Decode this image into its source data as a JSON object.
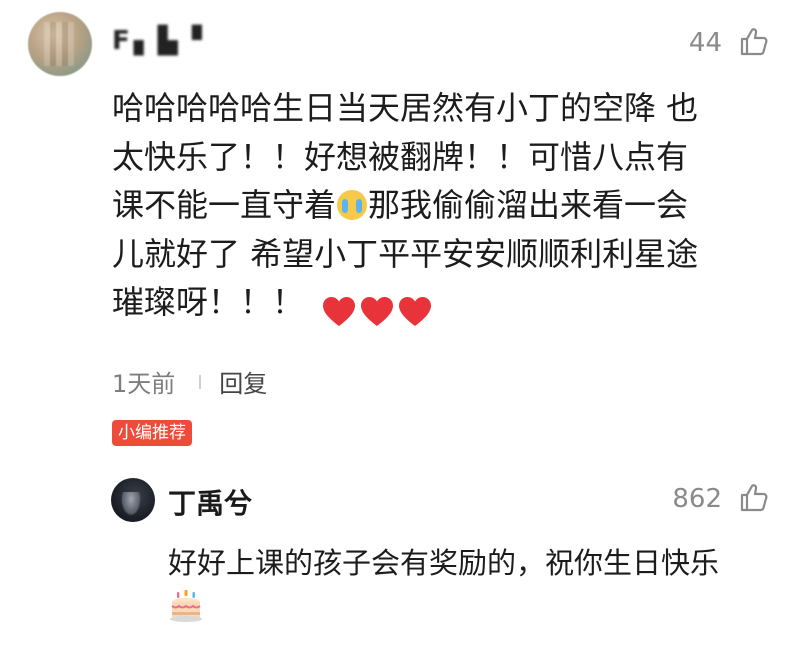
{
  "comment": {
    "username": "F▖▙▝",
    "like_count": "44",
    "text_lines": [
      "哈哈哈哈哈生日当天居然有小丁的空降 也",
      "太快乐了！！好想被翻牌！！可惜八点有",
      "课不能一直守着",
      "那我偷偷溜出来看一会",
      "儿就好了 希望小丁平平安安顺顺利利星途",
      "璀璨呀！！！"
    ],
    "inline_emoji": "crying-face-emoji",
    "trailing_emoji": "red-heart-emoji",
    "time": "1天前",
    "reply_label": "回复",
    "badge": "小编推荐"
  },
  "reply": {
    "name": "丁禹兮",
    "like_count": "862",
    "text": "好好上课的孩子会有奖励的，祝你生日快乐",
    "trailing_emoji": "birthday-cake-emoji"
  },
  "colors": {
    "badge_bg": "#ef4b3a",
    "heart": "#e8333b",
    "muted_text": "#8a8a8a"
  }
}
